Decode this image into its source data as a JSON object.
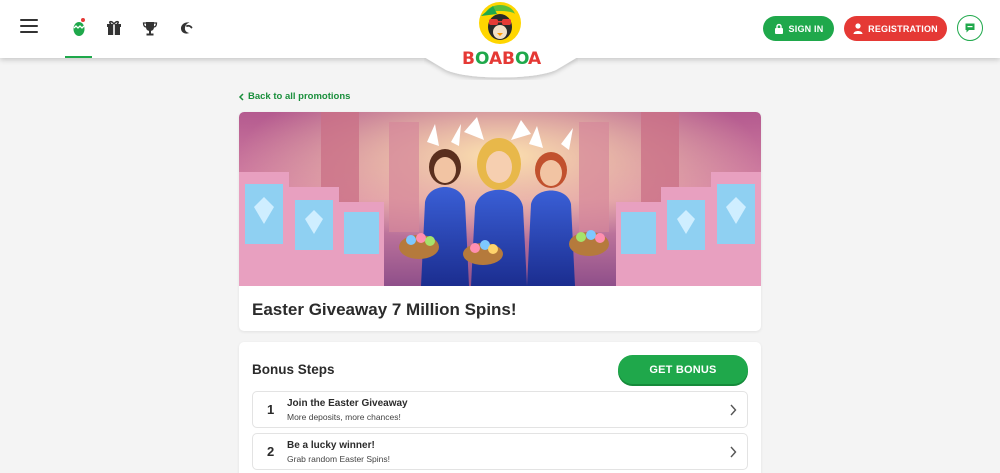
{
  "header": {
    "logo_text": "BOABOA",
    "nav_icons": [
      "menu-icon",
      "easter-egg-icon",
      "gift-icon",
      "trophy-icon",
      "moon-icon"
    ],
    "sign_in_label": "SIGN IN",
    "registration_label": "REGISTRATION"
  },
  "back_link": "Back to all promotions",
  "promo": {
    "title": "Easter Giveaway 7 Million Spins!"
  },
  "bonus": {
    "section_title": "Bonus Steps",
    "get_bonus_label": "GET BONUS",
    "steps": [
      {
        "number": "1",
        "title": "Join the Easter Giveaway",
        "subtitle": "More deposits, more chances!"
      },
      {
        "number": "2",
        "title": "Be a lucky winner!",
        "subtitle": "Grab random Easter Spins!"
      }
    ]
  },
  "colors": {
    "green": "#1fa84b",
    "red": "#e53935",
    "background": "#f4f4f4"
  }
}
